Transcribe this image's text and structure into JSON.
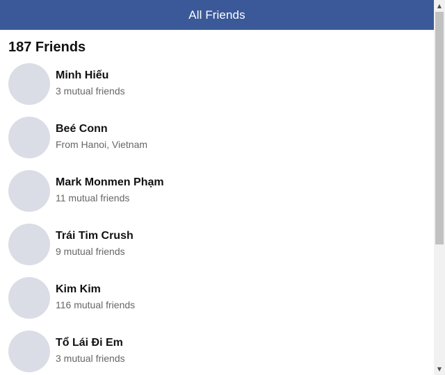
{
  "header": {
    "title": "All Friends"
  },
  "friends_count_label": "187 Friends",
  "friends": [
    {
      "name": "Minh Hiếu",
      "detail": "3 mutual friends"
    },
    {
      "name": "Beé Conn",
      "detail": "From Hanoi, Vietnam"
    },
    {
      "name": "Mark Monmen Phạm",
      "detail": "11 mutual friends"
    },
    {
      "name": "Trái Tim Crush",
      "detail": "9 mutual friends"
    },
    {
      "name": "Kim Kim",
      "detail": "116 mutual friends"
    },
    {
      "name": "Tổ Lái Đi Em",
      "detail": "3 mutual friends"
    }
  ],
  "colors": {
    "header_bg": "#3b5998",
    "avatar_placeholder": "#dadde6"
  },
  "icons": {
    "scroll_up": "scroll-up-arrow-icon",
    "scroll_down": "scroll-down-arrow-icon"
  }
}
